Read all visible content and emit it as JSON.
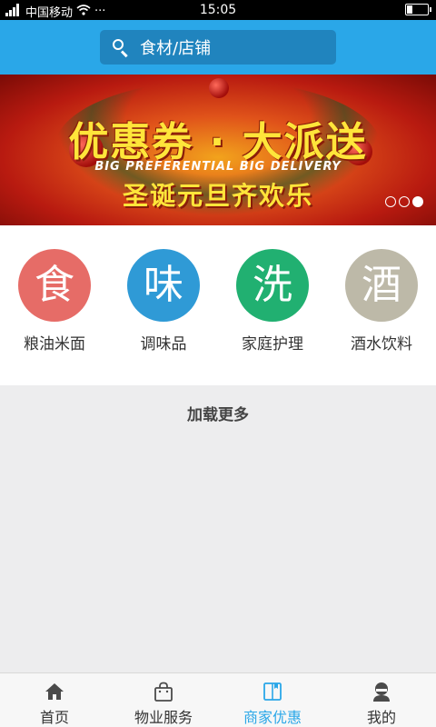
{
  "status_bar": {
    "carrier": "中国移动",
    "extra": "···",
    "time": "15:05",
    "battery_level": 0.25
  },
  "header": {
    "search_placeholder": "食材/店铺"
  },
  "banner": {
    "title": "优惠券 · 大派送",
    "subtitle_en": "BIG PREFERENTIAL BIG DELIVERY",
    "subtitle": "圣诞元旦齐欢乐",
    "pages": 3,
    "active_page": 3
  },
  "categories": [
    {
      "icon_char": "食",
      "label": "粮油米面",
      "color": "#e66c67"
    },
    {
      "icon_char": "味",
      "label": "调味品",
      "color": "#2f9ad6"
    },
    {
      "icon_char": "洗",
      "label": "家庭护理",
      "color": "#21b071"
    },
    {
      "icon_char": "酒",
      "label": "酒水饮料",
      "color": "#bdb9a8"
    }
  ],
  "load_more": "加载更多",
  "tabs": [
    {
      "label": "首页",
      "icon": "home-icon",
      "active": false
    },
    {
      "label": "物业服务",
      "icon": "bag-icon",
      "active": false
    },
    {
      "label": "商家优惠",
      "icon": "book-icon",
      "active": true
    },
    {
      "label": "我的",
      "icon": "user-icon",
      "active": false
    }
  ],
  "colors": {
    "accent": "#2aa7e8",
    "background": "#ededee"
  }
}
